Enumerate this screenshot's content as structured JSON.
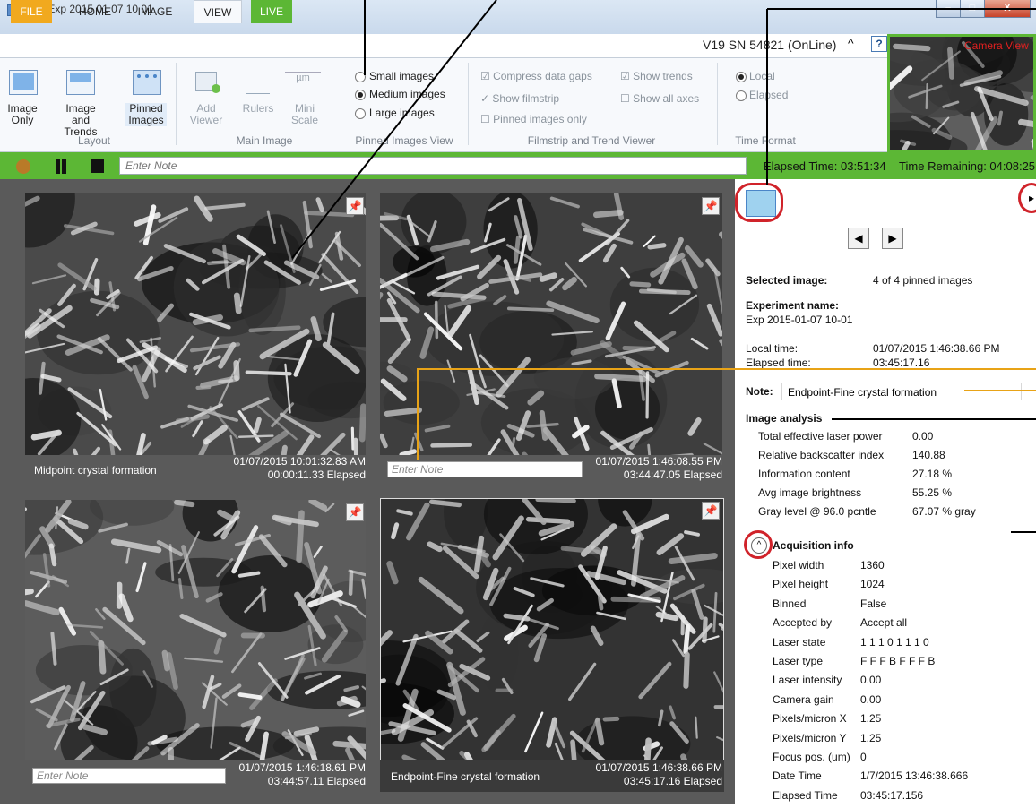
{
  "window": {
    "title": "Live  Exp 2015 01 07 10 01"
  },
  "tabs": {
    "file": "FILE",
    "home": "HOME",
    "image": "IMAGE",
    "view": "VIEW",
    "live": "LIVE"
  },
  "device": {
    "status": "V19 SN 54821 (OnLine)",
    "collapse_glyph": "^",
    "help": "?"
  },
  "ribbon": {
    "layout": {
      "group": "Layout",
      "image_only": [
        "Image",
        "Only"
      ],
      "image_trends": [
        "Image and",
        "Trends"
      ],
      "pinned": [
        "Pinned",
        "Images"
      ]
    },
    "main_image": {
      "group": "Main Image",
      "add_viewer": [
        "Add",
        "Viewer"
      ],
      "rulers": "Rulers",
      "mini_scale": [
        "Mini",
        "Scale"
      ],
      "scale_unit": "µm"
    },
    "pinned_view": {
      "group": "Pinned Images View",
      "small": "Small images",
      "medium": "Medium images",
      "large": "Large images",
      "selected": "medium"
    },
    "filmstrip": {
      "group": "Filmstrip and Trend Viewer",
      "compress": "Compress data gaps",
      "show_filmstrip": "Show filmstrip",
      "pinned_only": "Pinned images only",
      "show_trends": "Show trends",
      "show_all_axes": "Show all axes"
    },
    "time_format": {
      "group": "Time Format",
      "local": "Local",
      "elapsed": "Elapsed",
      "selected": "local"
    }
  },
  "camera": {
    "label": "Camera View"
  },
  "controls": {
    "note_placeholder": "Enter Note",
    "elapsed": "Elapsed Time: 03:51:34",
    "remaining": "Time Remaining: 04:08:25"
  },
  "images": [
    {
      "caption": "Midpoint crystal formation",
      "timestamp": "01/07/2015 10:01:32.83 AM",
      "elapsed": "00:00:11.33 Elapsed"
    },
    {
      "note_placeholder": "Enter Note",
      "timestamp": "01/07/2015 1:46:08.55 PM",
      "elapsed": "03:44:47.05 Elapsed"
    },
    {
      "note_placeholder": "Enter Note",
      "timestamp": "01/07/2015 1:46:18.61 PM",
      "elapsed": "03:44:57.11 Elapsed"
    },
    {
      "caption": "Endpoint-Fine crystal formation",
      "timestamp": "01/07/2015 1:46:38.66 PM",
      "elapsed": "03:45:17.16 Elapsed"
    }
  ],
  "info": {
    "selected_label": "Selected image:",
    "selected_value": "4 of 4 pinned images",
    "experiment_label": "Experiment name:",
    "experiment_value": "Exp 2015-01-07 10-01",
    "local_label": "Local time:",
    "local_value": "01/07/2015 1:46:38.66 PM",
    "elapsed_label": "Elapsed time:",
    "elapsed_value": "03:45:17.16",
    "note_label": "Note:",
    "note_value": "Endpoint-Fine crystal formation",
    "analysis_title": "Image analysis",
    "analysis": [
      {
        "k": "Total effective laser power",
        "v": "0.00"
      },
      {
        "k": "Relative backscatter index",
        "v": "140.88"
      },
      {
        "k": "Information content",
        "v": "27.18 %"
      },
      {
        "k": "Avg image brightness",
        "v": "55.25 %"
      },
      {
        "k": "Gray level @ 96.0 pcntle",
        "v": "67.07 % gray"
      }
    ],
    "acq_title": "Acquisition info",
    "acquisition": [
      {
        "k": "Pixel width",
        "v": "1360"
      },
      {
        "k": "Pixel height",
        "v": "1024"
      },
      {
        "k": "Binned",
        "v": "False"
      },
      {
        "k": "Accepted by",
        "v": "Accept all"
      },
      {
        "k": "Laser state",
        "v": "1 1 1 0 1 1 1 0"
      },
      {
        "k": "Laser type",
        "v": "F F F B F F F B"
      },
      {
        "k": "Laser intensity",
        "v": "0.00"
      },
      {
        "k": "Camera gain",
        "v": "0.00"
      },
      {
        "k": "Pixels/micron X",
        "v": "1.25"
      },
      {
        "k": "Pixels/micron Y",
        "v": "1.25"
      },
      {
        "k": "Focus pos. (um)",
        "v": "0"
      },
      {
        "k": "Date Time",
        "v": "1/7/2015 13:46:38.666"
      },
      {
        "k": "Elapsed Time",
        "v": "03:45:17.156"
      }
    ]
  },
  "colors": {
    "live_green": "#5cb735",
    "file_orange": "#f1a91e",
    "annotation_red": "#d0232a",
    "annotation_gold": "#e8a317"
  }
}
